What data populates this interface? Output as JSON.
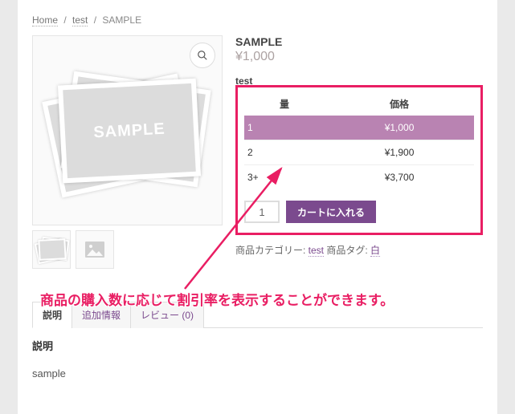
{
  "breadcrumb": {
    "home": "Home",
    "parent": "test",
    "current": "SAMPLE"
  },
  "product": {
    "title": "SAMPLE",
    "price": "¥1,000",
    "category_link_label": "test",
    "placeholder_label": "SAMPLE"
  },
  "tier_table": {
    "header_qty": "量",
    "header_price": "価格",
    "rows": [
      {
        "qty": "1",
        "price": "¥1,000",
        "highlight": true
      },
      {
        "qty": "2",
        "price": "¥1,900",
        "highlight": false
      },
      {
        "qty": "3+",
        "price": "¥3,700",
        "highlight": false
      }
    ]
  },
  "cart": {
    "qty_value": "1",
    "button_label": "カートに入れる"
  },
  "meta": {
    "category_prefix": "商品カテゴリー: ",
    "category_link": "test",
    "tag_prefix": " 商品タグ: ",
    "tag_link": "白"
  },
  "callout": {
    "text": "商品の購入数に応じて割引率を表示することができます。"
  },
  "tabs": {
    "description": "説明",
    "additional": "追加情報",
    "reviews": "レビュー (0)"
  },
  "description": {
    "heading": "説明",
    "body": "sample"
  },
  "cat_top_label": "test"
}
